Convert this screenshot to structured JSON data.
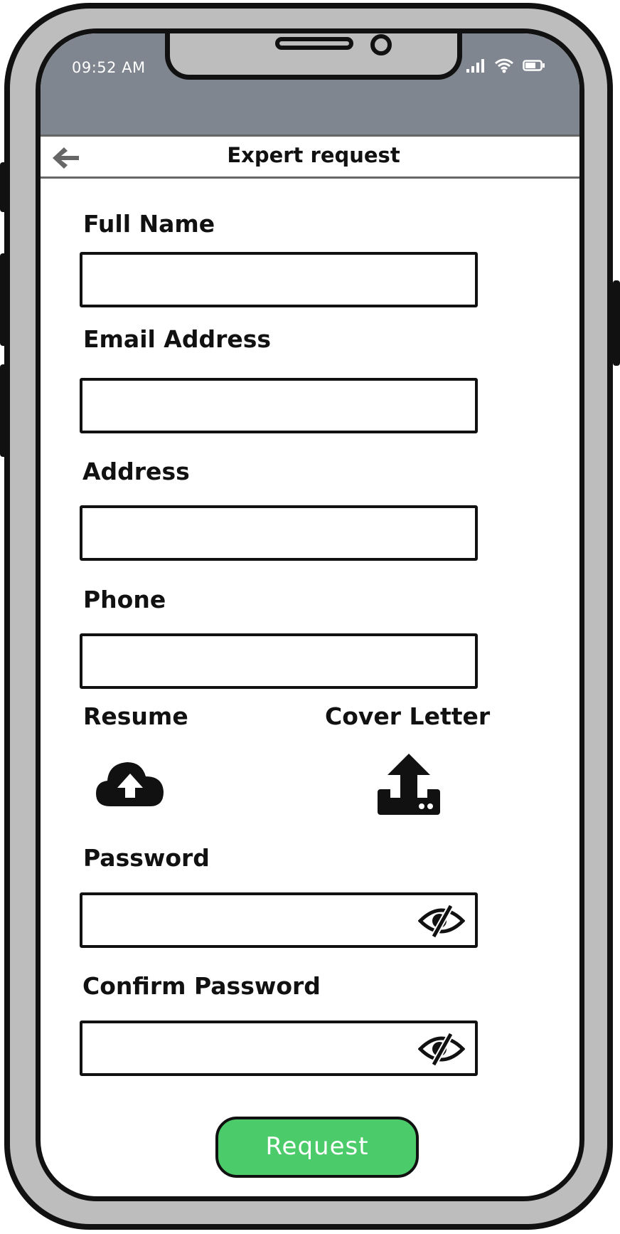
{
  "status_bar": {
    "time": "09:52 AM",
    "icons": [
      "signal-icon",
      "wifi-icon",
      "battery-icon"
    ]
  },
  "header": {
    "title": "Expert request",
    "back_icon": "arrow-left-icon"
  },
  "form": {
    "full_name_label": "Full Name",
    "email_label": "Email Address",
    "address_label": "Address",
    "phone_label": "Phone",
    "resume_label": "Resume",
    "cover_letter_label": "Cover Letter",
    "password_label": "Password",
    "confirm_password_label": "Confirm Password",
    "full_name_value": "",
    "email_value": "",
    "address_value": "",
    "phone_value": "",
    "password_value": "",
    "confirm_password_value": "",
    "resume_icon": "cloud-upload-icon",
    "cover_letter_icon": "tray-upload-icon",
    "password_toggle_icon": "eye-slash-icon"
  },
  "actions": {
    "request_label": "Request"
  },
  "colors": {
    "status_bar": "#80868f",
    "phone_frame": "#bdbdbd",
    "request_button": "#4bcb69"
  }
}
